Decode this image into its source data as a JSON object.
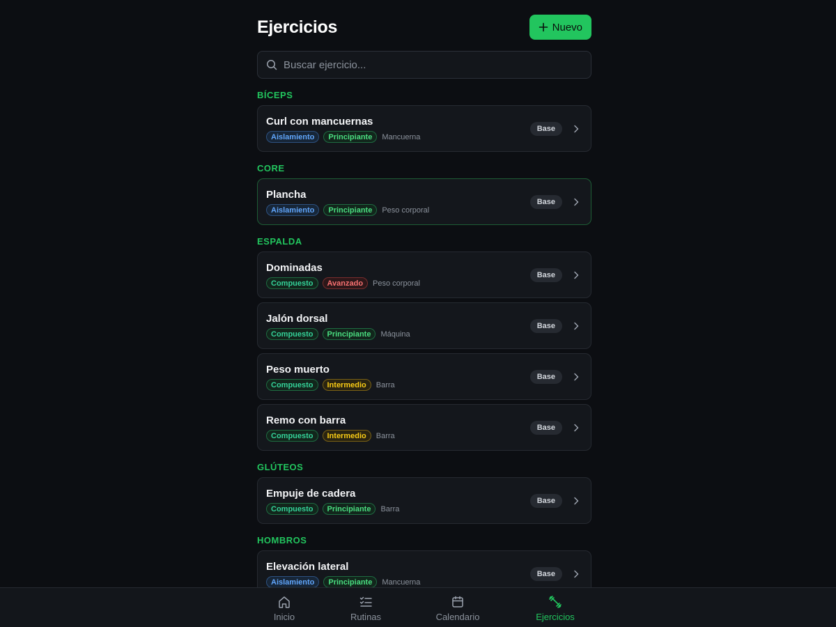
{
  "header": {
    "title": "Ejercicios",
    "new_label": "Nuevo"
  },
  "search": {
    "placeholder": "Buscar ejercicio..."
  },
  "sections": [
    {
      "label": "BÍCEPS",
      "items": [
        {
          "name": "Curl con mancuernas",
          "type": "Aislamiento",
          "level": "Principiante",
          "equipment": "Mancuerna",
          "badge": "Base"
        }
      ]
    },
    {
      "label": "CORE",
      "items": [
        {
          "name": "Plancha",
          "type": "Aislamiento",
          "level": "Principiante",
          "equipment": "Peso corporal",
          "badge": "Base"
        }
      ]
    },
    {
      "label": "ESPALDA",
      "items": [
        {
          "name": "Dominadas",
          "type": "Compuesto",
          "level": "Avanzado",
          "equipment": "Peso corporal",
          "badge": "Base"
        },
        {
          "name": "Jalón dorsal",
          "type": "Compuesto",
          "level": "Principiante",
          "equipment": "Máquina",
          "badge": "Base"
        },
        {
          "name": "Peso muerto",
          "type": "Compuesto",
          "level": "Intermedio",
          "equipment": "Barra",
          "badge": "Base"
        },
        {
          "name": "Remo con barra",
          "type": "Compuesto",
          "level": "Intermedio",
          "equipment": "Barra",
          "badge": "Base"
        }
      ]
    },
    {
      "label": "GLÚTEOS",
      "items": [
        {
          "name": "Empuje de cadera",
          "type": "Compuesto",
          "level": "Principiante",
          "equipment": "Barra",
          "badge": "Base"
        }
      ]
    },
    {
      "label": "HOMBROS",
      "items": [
        {
          "name": "Elevación lateral",
          "type": "Aislamiento",
          "level": "Principiante",
          "equipment": "Mancuerna",
          "badge": "Base"
        }
      ]
    }
  ],
  "nav": [
    {
      "label": "Inicio",
      "icon": "home-icon",
      "active": false
    },
    {
      "label": "Rutinas",
      "icon": "checklist-icon",
      "active": false
    },
    {
      "label": "Calendario",
      "icon": "calendar-icon",
      "active": false
    },
    {
      "label": "Ejercicios",
      "icon": "dumbbell-icon",
      "active": true
    }
  ],
  "colors": {
    "accent": "#22c55e",
    "background": "#0c0e12",
    "card": "#14171c"
  }
}
